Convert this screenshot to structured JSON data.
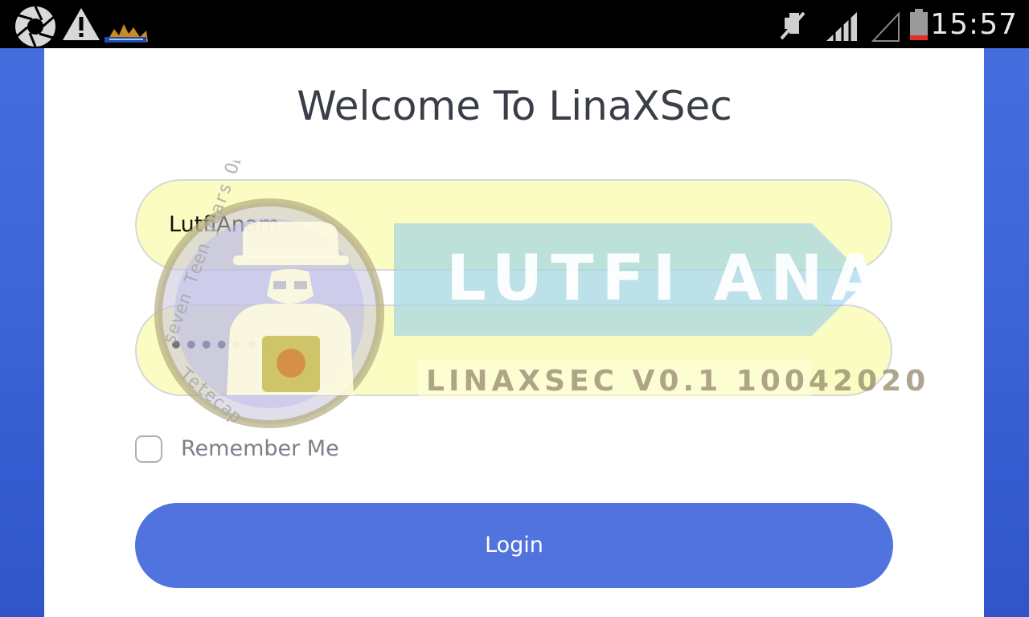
{
  "status_bar": {
    "time": "15:57",
    "icons": [
      "aperture-icon",
      "warning-icon",
      "app-logo-icon",
      "muted-icon",
      "signal-icon",
      "signal-empty-icon",
      "battery-low-icon"
    ]
  },
  "login": {
    "title": "Welcome To LinaXSec",
    "username_value": "LutfiAnam",
    "password_mask": "•••••••",
    "remember_label": "Remember Me",
    "remember_checked": false,
    "button_label": "Login"
  },
  "watermark": {
    "banner_text": "LUTFI ANAM",
    "version_text": "LINAXSEC V0.1 10042020",
    "ring_text": "seven Teen years OLD Tetecap"
  },
  "colors": {
    "background": "#3d66d9",
    "card": "#ffffff",
    "field_fill": "#fbfcc2",
    "button": "#5073de",
    "title": "#3a3e48"
  }
}
